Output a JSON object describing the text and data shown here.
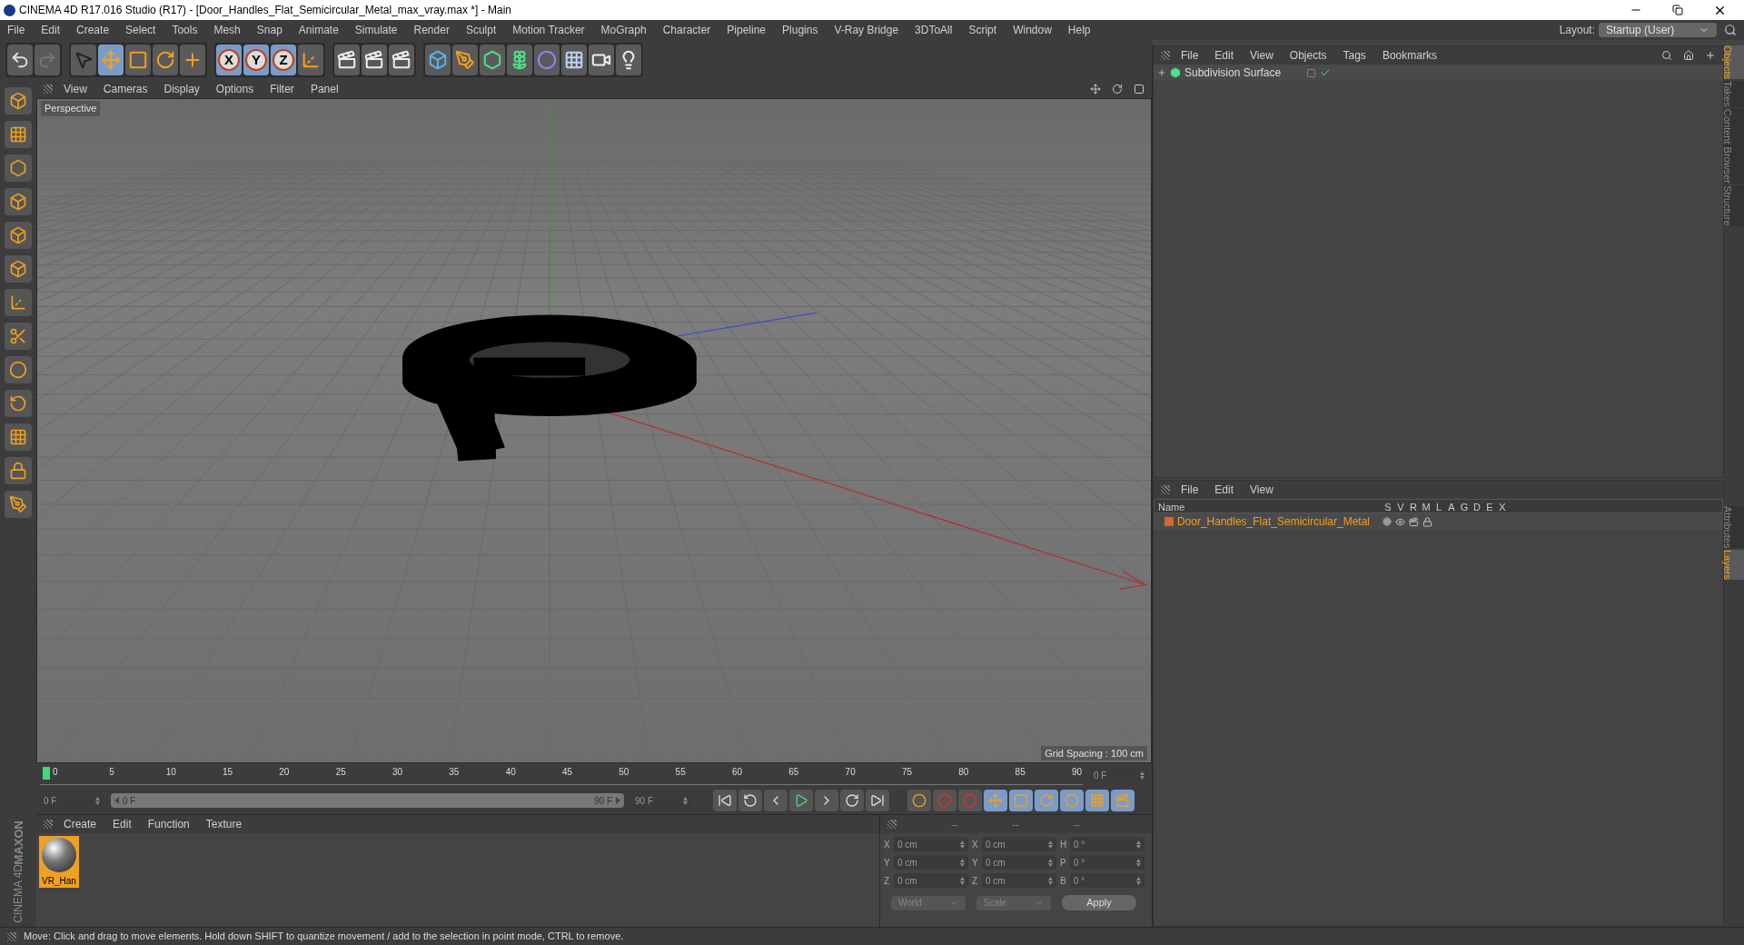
{
  "window": {
    "title": "CINEMA 4D R17.016 Studio (R17) - [Door_Handles_Flat_Semicircular_Metal_max_vray.max *] - Main"
  },
  "menu": [
    "File",
    "Edit",
    "Create",
    "Select",
    "Tools",
    "Mesh",
    "Snap",
    "Animate",
    "Simulate",
    "Render",
    "Sculpt",
    "Motion Tracker",
    "MoGraph",
    "Character",
    "Pipeline",
    "Plugins",
    "V-Ray Bridge",
    "3DToAll",
    "Script",
    "Window",
    "Help"
  ],
  "layout": {
    "label": "Layout:",
    "value": "Startup (User)"
  },
  "toolbar": [
    [
      {
        "kind": "undo",
        "selected": false
      },
      {
        "kind": "redo",
        "selected": false
      }
    ],
    [
      {
        "kind": "select",
        "selected": false
      },
      {
        "kind": "move",
        "selected": true
      },
      {
        "kind": "scale",
        "selected": false
      },
      {
        "kind": "rotate",
        "selected": false
      },
      {
        "kind": "add",
        "selected": false
      }
    ],
    [
      {
        "kind": "axis",
        "label": "X",
        "selected": true
      },
      {
        "kind": "axis",
        "label": "Y",
        "selected": true
      },
      {
        "kind": "axis",
        "label": "Z",
        "selected": true
      },
      {
        "kind": "coords",
        "selected": false
      }
    ],
    [
      {
        "kind": "render",
        "selected": false
      },
      {
        "kind": "render",
        "selected": false
      },
      {
        "kind": "render",
        "selected": false
      }
    ],
    [
      {
        "kind": "cube",
        "selected": false
      },
      {
        "kind": "pen",
        "selected": false
      },
      {
        "kind": "subdiv",
        "selected": false
      },
      {
        "kind": "cloner",
        "selected": false
      },
      {
        "kind": "deformer",
        "selected": false
      },
      {
        "kind": "floor",
        "selected": false
      },
      {
        "kind": "camera",
        "selected": false
      },
      {
        "kind": "light",
        "selected": false
      }
    ]
  ],
  "viewport": {
    "menu": [
      "View",
      "Cameras",
      "Display",
      "Options",
      "Filter",
      "Panel"
    ],
    "camera": "Perspective",
    "grid_label": "Grid Spacing : 100 cm"
  },
  "timeline": {
    "ticks": [
      "0",
      "5",
      "10",
      "15",
      "20",
      "25",
      "30",
      "35",
      "40",
      "45",
      "50",
      "55",
      "60",
      "65",
      "70",
      "75",
      "80",
      "85",
      "90"
    ],
    "current": "0 F",
    "start": "0 F",
    "range_start": "0 F",
    "range_end": "90 F",
    "range_slider": {
      "level": 1
    },
    "end": "90 F"
  },
  "materials": {
    "menu": [
      "Create",
      "Edit",
      "Function",
      "Texture"
    ],
    "items": [
      {
        "name": "VR_Han",
        "selected": true
      }
    ]
  },
  "coordinates": {
    "headers": [
      "--",
      "--",
      "--"
    ],
    "columns": [
      [
        {
          "axis": "X",
          "value": "0 cm"
        },
        {
          "axis": "Y",
          "value": "0 cm"
        },
        {
          "axis": "Z",
          "value": "0 cm"
        }
      ],
      [
        {
          "axis": "X",
          "value": "0 cm"
        },
        {
          "axis": "Y",
          "value": "0 cm"
        },
        {
          "axis": "Z",
          "value": "0 cm"
        }
      ],
      [
        {
          "axis": "H",
          "value": "0 °"
        },
        {
          "axis": "P",
          "value": "0 °"
        },
        {
          "axis": "B",
          "value": "0 °"
        }
      ]
    ],
    "mode": "World",
    "size_mode": "Scale",
    "apply": "Apply"
  },
  "logo": [
    "MAXON",
    "CINEMA 4D"
  ],
  "status_bar": "Move: Click and drag to move elements. Hold down SHIFT to quantize movement / add to the selection in point mode, CTRL to remove.",
  "objects_panel": {
    "menu": [
      "File",
      "Edit",
      "View",
      "Objects",
      "Tags",
      "Bookmarks"
    ],
    "objects": [
      {
        "name": "Subdivision Surface",
        "enabled": true
      }
    ]
  },
  "layers_panel": {
    "menu": [
      "File",
      "Edit",
      "View"
    ],
    "columns": [
      "Name",
      "S",
      "V",
      "R",
      "M",
      "L",
      "A",
      "G",
      "D",
      "E",
      "X"
    ],
    "rows": [
      {
        "name": "Door_Handles_Flat_Semicircular_Metal",
        "color": "#d9652b"
      }
    ]
  },
  "side_tabs_top": [
    {
      "label": "Objects",
      "selected": true
    },
    {
      "label": "Takes",
      "selected": false
    },
    {
      "label": "Content Browser",
      "selected": false
    },
    {
      "label": "Structure",
      "selected": false
    }
  ],
  "side_tabs_bottom": [
    {
      "label": "Attributes",
      "selected": false
    },
    {
      "label": "Layers",
      "selected": true
    }
  ]
}
